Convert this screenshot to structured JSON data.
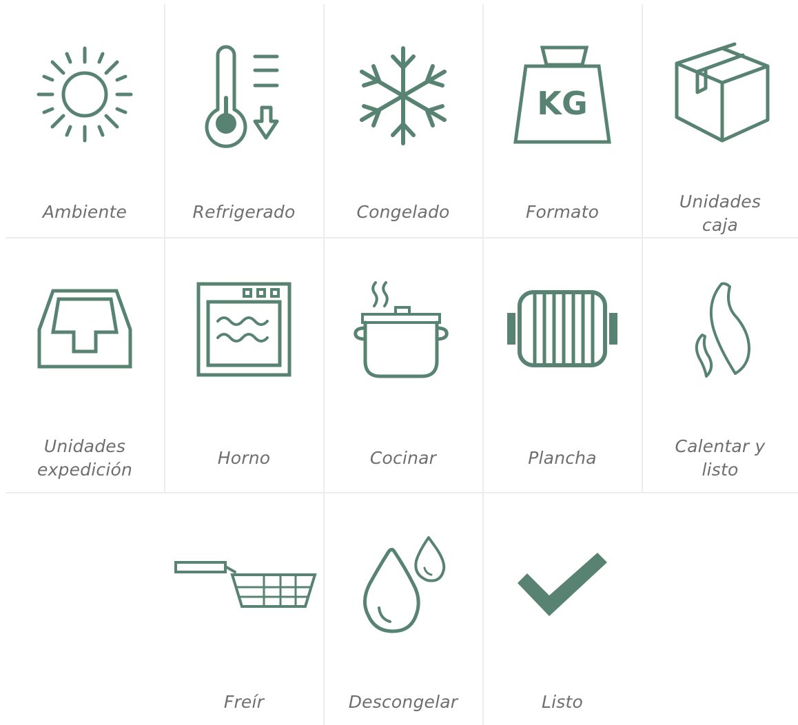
{
  "colors": {
    "icon": "#588372",
    "label": "#6e6e6e",
    "divider": "#ececec"
  },
  "items": [
    {
      "label": "Ambiente",
      "icon": "sun-icon"
    },
    {
      "label": "Refrigerado",
      "icon": "thermometer-down-icon"
    },
    {
      "label": "Congelado",
      "icon": "snowflake-icon"
    },
    {
      "label": "Formato",
      "icon": "kg-weight-icon",
      "icon_text": "KG"
    },
    {
      "label": "Unidades caja",
      "icon": "box-icon"
    },
    {
      "label": "Unidades expedición",
      "icon": "tray-icon"
    },
    {
      "label": "Horno",
      "icon": "oven-icon"
    },
    {
      "label": "Cocinar",
      "icon": "cooking-pot-icon"
    },
    {
      "label": "Plancha",
      "icon": "griddle-icon"
    },
    {
      "label": "Calentar y listo",
      "icon": "flame-icon"
    },
    {
      "label": "Freír",
      "icon": "fryer-basket-icon"
    },
    {
      "label": "Descongelar",
      "icon": "water-drops-icon"
    },
    {
      "label": "Listo",
      "icon": "checkmark-icon"
    }
  ]
}
